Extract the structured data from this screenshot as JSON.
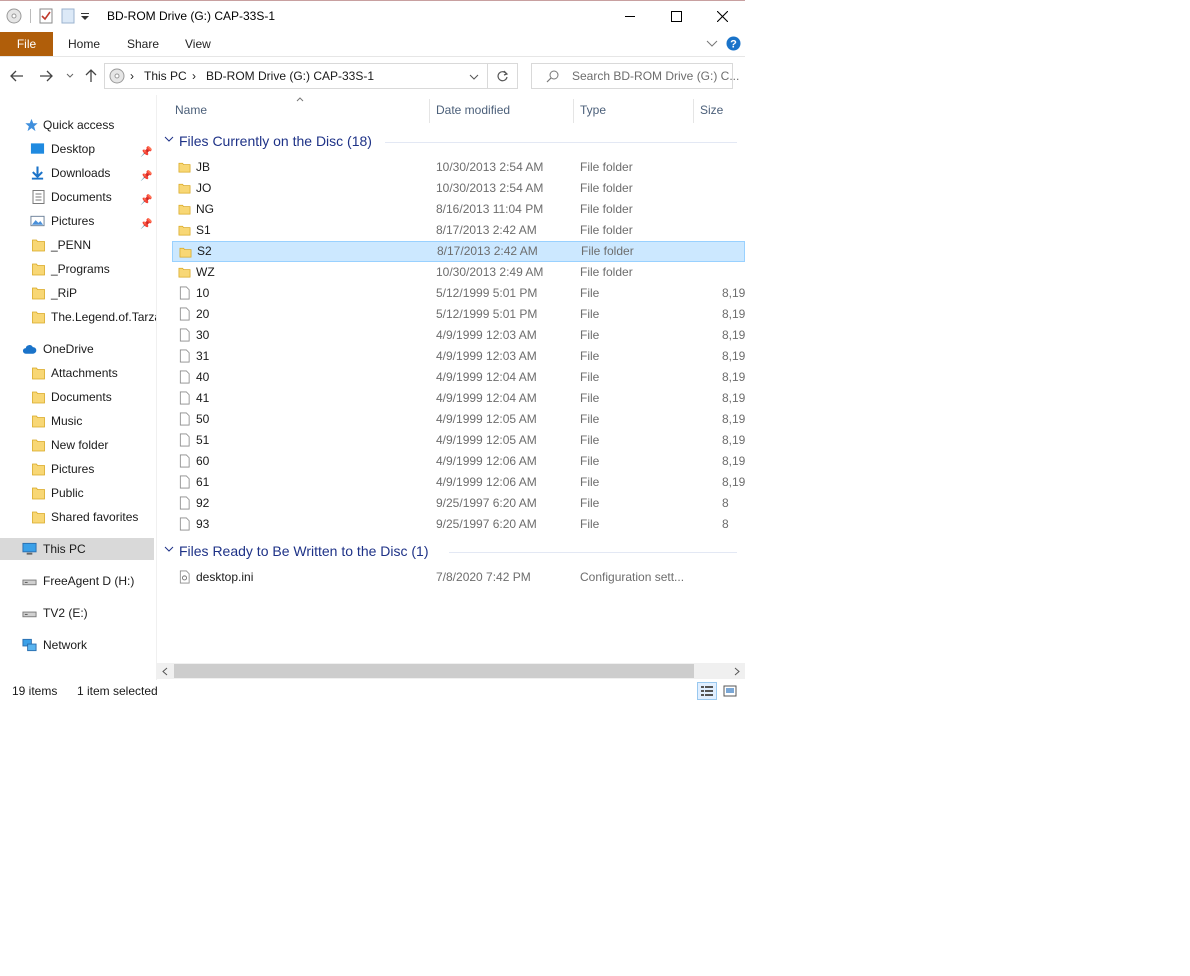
{
  "window": {
    "title": "BD-ROM Drive (G:) CAP-33S-1"
  },
  "ribbon": {
    "tabs": [
      "File",
      "Home",
      "Share",
      "View"
    ]
  },
  "address": {
    "crumbs": [
      "This PC",
      "BD-ROM Drive (G:) CAP-33S-1"
    ],
    "search_placeholder": "Search BD-ROM Drive (G:) C..."
  },
  "nav": {
    "quick_access": "Quick access",
    "quick_items": [
      {
        "label": "Desktop",
        "pinned": true,
        "icon": "desktop-icon"
      },
      {
        "label": "Downloads",
        "pinned": true,
        "icon": "download-icon"
      },
      {
        "label": "Documents",
        "pinned": true,
        "icon": "documents-icon"
      },
      {
        "label": "Pictures",
        "pinned": true,
        "icon": "pictures-icon"
      },
      {
        "label": "_PENN",
        "pinned": false,
        "icon": "folder-icon"
      },
      {
        "label": "_Programs",
        "pinned": false,
        "icon": "folder-icon"
      },
      {
        "label": "_RiP",
        "pinned": false,
        "icon": "folder-icon"
      },
      {
        "label": "The.Legend.of.Tarza",
        "pinned": false,
        "icon": "folder-icon"
      }
    ],
    "onedrive": "OneDrive",
    "onedrive_items": [
      "Attachments",
      "Documents",
      "Music",
      "New folder",
      "Pictures",
      "Public",
      "Shared favorites"
    ],
    "this_pc": "This PC",
    "drives": [
      "FreeAgent D (H:)",
      "TV2 (E:)"
    ],
    "network": "Network"
  },
  "columns": {
    "name": "Name",
    "date": "Date modified",
    "type": "Type",
    "size": "Size"
  },
  "groups": {
    "on_disc": "Files Currently on the Disc (18)",
    "ready": "Files Ready to Be Written to the Disc (1)"
  },
  "files": [
    {
      "name": "JB",
      "date": "10/30/2013 2:54 AM",
      "type": "File folder",
      "size": "",
      "kind": "folder"
    },
    {
      "name": "JO",
      "date": "10/30/2013 2:54 AM",
      "type": "File folder",
      "size": "",
      "kind": "folder"
    },
    {
      "name": "NG",
      "date": "8/16/2013 11:04 PM",
      "type": "File folder",
      "size": "",
      "kind": "folder"
    },
    {
      "name": "S1",
      "date": "8/17/2013 2:42 AM",
      "type": "File folder",
      "size": "",
      "kind": "folder"
    },
    {
      "name": "S2",
      "date": "8/17/2013 2:42 AM",
      "type": "File folder",
      "size": "",
      "kind": "folder",
      "selected": true
    },
    {
      "name": "WZ",
      "date": "10/30/2013 2:49 AM",
      "type": "File folder",
      "size": "",
      "kind": "folder"
    },
    {
      "name": "10",
      "date": "5/12/1999 5:01 PM",
      "type": "File",
      "size": "8,19",
      "kind": "file"
    },
    {
      "name": "20",
      "date": "5/12/1999 5:01 PM",
      "type": "File",
      "size": "8,19",
      "kind": "file"
    },
    {
      "name": "30",
      "date": "4/9/1999 12:03 AM",
      "type": "File",
      "size": "8,19",
      "kind": "file"
    },
    {
      "name": "31",
      "date": "4/9/1999 12:03 AM",
      "type": "File",
      "size": "8,19",
      "kind": "file"
    },
    {
      "name": "40",
      "date": "4/9/1999 12:04 AM",
      "type": "File",
      "size": "8,19",
      "kind": "file"
    },
    {
      "name": "41",
      "date": "4/9/1999 12:04 AM",
      "type": "File",
      "size": "8,19",
      "kind": "file"
    },
    {
      "name": "50",
      "date": "4/9/1999 12:05 AM",
      "type": "File",
      "size": "8,19",
      "kind": "file"
    },
    {
      "name": "51",
      "date": "4/9/1999 12:05 AM",
      "type": "File",
      "size": "8,19",
      "kind": "file"
    },
    {
      "name": "60",
      "date": "4/9/1999 12:06 AM",
      "type": "File",
      "size": "8,19",
      "kind": "file"
    },
    {
      "name": "61",
      "date": "4/9/1999 12:06 AM",
      "type": "File",
      "size": "8,19",
      "kind": "file"
    },
    {
      "name": "92",
      "date": "9/25/1997 6:20 AM",
      "type": "File",
      "size": "8",
      "kind": "file"
    },
    {
      "name": "93",
      "date": "9/25/1997 6:20 AM",
      "type": "File",
      "size": "8",
      "kind": "file"
    }
  ],
  "pending": [
    {
      "name": "desktop.ini",
      "date": "7/8/2020 7:42 PM",
      "type": "Configuration sett...",
      "size": "",
      "kind": "ini"
    }
  ],
  "status": {
    "items": "19 items",
    "selected": "1 item selected"
  },
  "colors": {
    "file_tab": "#b05e0a",
    "selection": "#cce8ff",
    "group_text": "#1e3287",
    "folder": "#f8d775"
  }
}
